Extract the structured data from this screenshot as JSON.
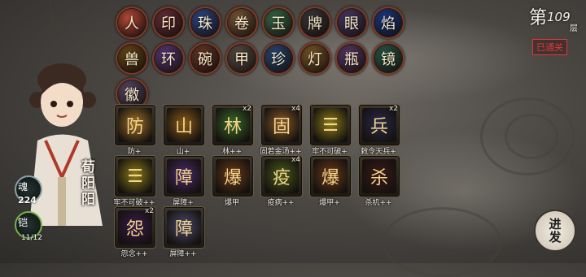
{
  "level": {
    "prefix": "第",
    "number": "109",
    "suffix": "层",
    "status": "已通关"
  },
  "advance_label": "进发",
  "character_name": "荀阳阳",
  "stats": {
    "soul": "224",
    "armor": "11/12",
    "soul_glyph": "魂",
    "armor_glyph": "铠"
  },
  "relics": [
    {
      "icon": "figurine-icon",
      "glyph": "人",
      "color": "#b94a3a"
    },
    {
      "icon": "seal-icon",
      "glyph": "印",
      "color": "#6a2f3a"
    },
    {
      "icon": "orb-cluster-icon",
      "glyph": "珠",
      "color": "#2e4a8a"
    },
    {
      "icon": "scroll-icon",
      "glyph": "卷",
      "color": "#7a5a3a"
    },
    {
      "icon": "jade-icon",
      "glyph": "玉",
      "color": "#3a6a4a"
    },
    {
      "icon": "tablet-icon",
      "glyph": "牌",
      "color": "#3a3a3a"
    },
    {
      "icon": "eye-icon",
      "glyph": "眼",
      "color": "#4a3a6a"
    },
    {
      "icon": "blue-flame-icon",
      "glyph": "焰",
      "color": "#1a3a8a"
    },
    {
      "icon": "golden-beast-icon",
      "glyph": "兽",
      "color": "#6a4a1a"
    },
    {
      "icon": "ring-icon",
      "glyph": "环",
      "color": "#5a3a7a"
    },
    {
      "icon": "bowl-icon",
      "glyph": "碗",
      "color": "#6a3a2a"
    },
    {
      "icon": "armor-icon",
      "glyph": "甲",
      "color": "#5a5048"
    },
    {
      "icon": "pearls-icon",
      "glyph": "珍",
      "color": "#2a4a7a"
    },
    {
      "icon": "lantern-icon",
      "glyph": "灯",
      "color": "#7a5a2a"
    },
    {
      "icon": "vase-icon",
      "glyph": "瓶",
      "color": "#5a3a6a"
    },
    {
      "icon": "mirror-icon",
      "glyph": "镜",
      "color": "#2a5a4a"
    },
    {
      "icon": "crest-icon",
      "glyph": "徽",
      "color": "#5a4a6a"
    }
  ],
  "cards": [
    {
      "label": "防+",
      "count": "",
      "icon": "lantern-shield-icon",
      "glyph": "防",
      "color": "#a0702a"
    },
    {
      "label": "山+",
      "count": "",
      "icon": "mountain-icon",
      "glyph": "山",
      "color": "#8a5a1a"
    },
    {
      "label": "林++",
      "count": "x2",
      "icon": "forest-icon",
      "glyph": "林",
      "color": "#3a6a2a"
    },
    {
      "label": "固若金汤++",
      "count": "x4",
      "icon": "golden-wall-icon",
      "glyph": "固",
      "color": "#8a5a2a"
    },
    {
      "label": "牢不可破+",
      "count": "",
      "icon": "barrier-icon",
      "glyph": "☰",
      "color": "#8a7a1a"
    },
    {
      "label": "敕令天兵+",
      "count": "x2",
      "icon": "heavenly-soldier-icon",
      "glyph": "兵",
      "color": "#2a2a4a"
    },
    {
      "label": "牢不可破++",
      "count": "",
      "icon": "barrier-icon",
      "glyph": "☰",
      "color": "#8a7a1a"
    },
    {
      "label": "屏障+",
      "count": "",
      "icon": "purple-shield-icon",
      "glyph": "障",
      "color": "#4a2a6a"
    },
    {
      "label": "爆甲",
      "count": "",
      "icon": "explosive-armor-icon",
      "glyph": "爆",
      "color": "#6a3a1a"
    },
    {
      "label": "疫病++",
      "count": "x4",
      "icon": "plague-icon",
      "glyph": "疫",
      "color": "#4a5a1a"
    },
    {
      "label": "爆甲+",
      "count": "",
      "icon": "explosive-armor-icon",
      "glyph": "爆",
      "color": "#6a3a1a"
    },
    {
      "label": "杀机++",
      "count": "",
      "icon": "killing-intent-icon",
      "glyph": "杀",
      "color": "#3a1a1a"
    },
    {
      "label": "怨念++",
      "count": "x2",
      "icon": "resentment-vortex-icon",
      "glyph": "怨",
      "color": "#3a1a4a"
    },
    {
      "label": "屏障++",
      "count": "",
      "icon": "spirit-shield-icon",
      "glyph": "障",
      "color": "#4a4a6a"
    }
  ]
}
